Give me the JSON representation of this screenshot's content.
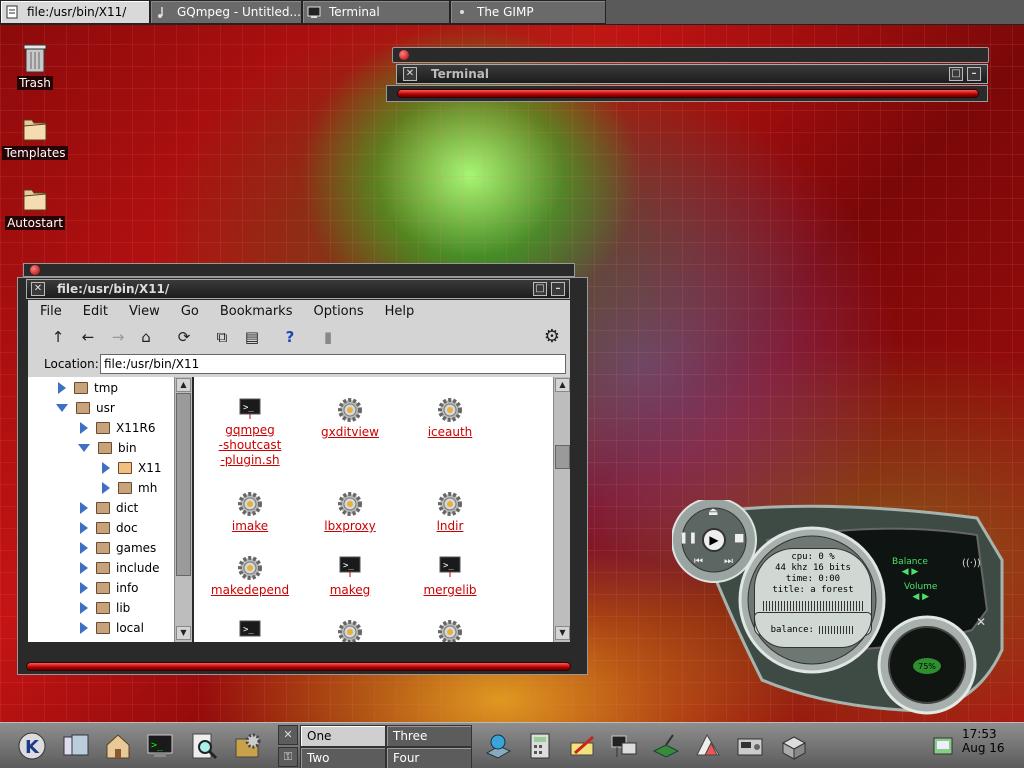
{
  "taskbar": {
    "tasks": [
      {
        "label": "file:/usr/bin/X11/",
        "active": true
      },
      {
        "label": "GQmpeg - Untitled...",
        "active": false
      },
      {
        "label": "Terminal",
        "active": false
      },
      {
        "label": "The GIMP",
        "active": false
      }
    ]
  },
  "desktop_icons": [
    {
      "label": "Trash",
      "icon": "trash-icon"
    },
    {
      "label": "Templates",
      "icon": "folder-icon"
    },
    {
      "label": "Autostart",
      "icon": "folder-icon"
    }
  ],
  "terminal": {
    "title": "Terminal"
  },
  "konqueror": {
    "title": "file:/usr/bin/X11/",
    "menu": [
      "File",
      "Edit",
      "View",
      "Go",
      "Bookmarks",
      "Options",
      "Help"
    ],
    "location_label": "Location:",
    "location_value": "file:/usr/bin/X11",
    "tree": [
      {
        "label": "tmp",
        "expanded": false
      },
      {
        "label": "usr",
        "expanded": true
      },
      {
        "label": "X11R6",
        "expanded": false
      },
      {
        "label": "bin",
        "expanded": true
      },
      {
        "label": "X11",
        "expanded": false
      },
      {
        "label": "mh",
        "expanded": false
      },
      {
        "label": "dict",
        "expanded": false
      },
      {
        "label": "doc",
        "expanded": false
      },
      {
        "label": "games",
        "expanded": false
      },
      {
        "label": "include",
        "expanded": false
      },
      {
        "label": "info",
        "expanded": false
      },
      {
        "label": "lib",
        "expanded": false
      },
      {
        "label": "local",
        "expanded": false
      }
    ],
    "files": [
      {
        "name": "gqmpeg\n-shoutcast\n-plugin.sh",
        "icon": "terminal-file-icon"
      },
      {
        "name": "gxditview",
        "icon": "gear-file-icon"
      },
      {
        "name": "iceauth",
        "icon": "gear-file-icon"
      },
      {
        "name": "imake",
        "icon": "gear-file-icon"
      },
      {
        "name": "lbxproxy",
        "icon": "gear-file-icon"
      },
      {
        "name": "lndir",
        "icon": "gear-file-icon"
      },
      {
        "name": "makedepend",
        "icon": "gear-file-icon"
      },
      {
        "name": "makeg",
        "icon": "terminal-file-icon"
      },
      {
        "name": "mergelib",
        "icon": "terminal-file-icon"
      }
    ]
  },
  "player": {
    "cpu": "cpu: 0 %",
    "format": "44 khz  16 bits",
    "time": "time:  0:00",
    "title": "title: a forest",
    "balance_readout": "balance:",
    "balance_label": "Balance",
    "volume_label": "Volume",
    "volume_knob": "75%"
  },
  "panel": {
    "desktops": [
      {
        "label": "One",
        "active": true
      },
      {
        "label": "Three",
        "active": false
      },
      {
        "label": "Two",
        "active": false
      },
      {
        "label": "Four",
        "active": false
      }
    ],
    "clock_time": "17:53",
    "clock_date": "Aug 16"
  }
}
